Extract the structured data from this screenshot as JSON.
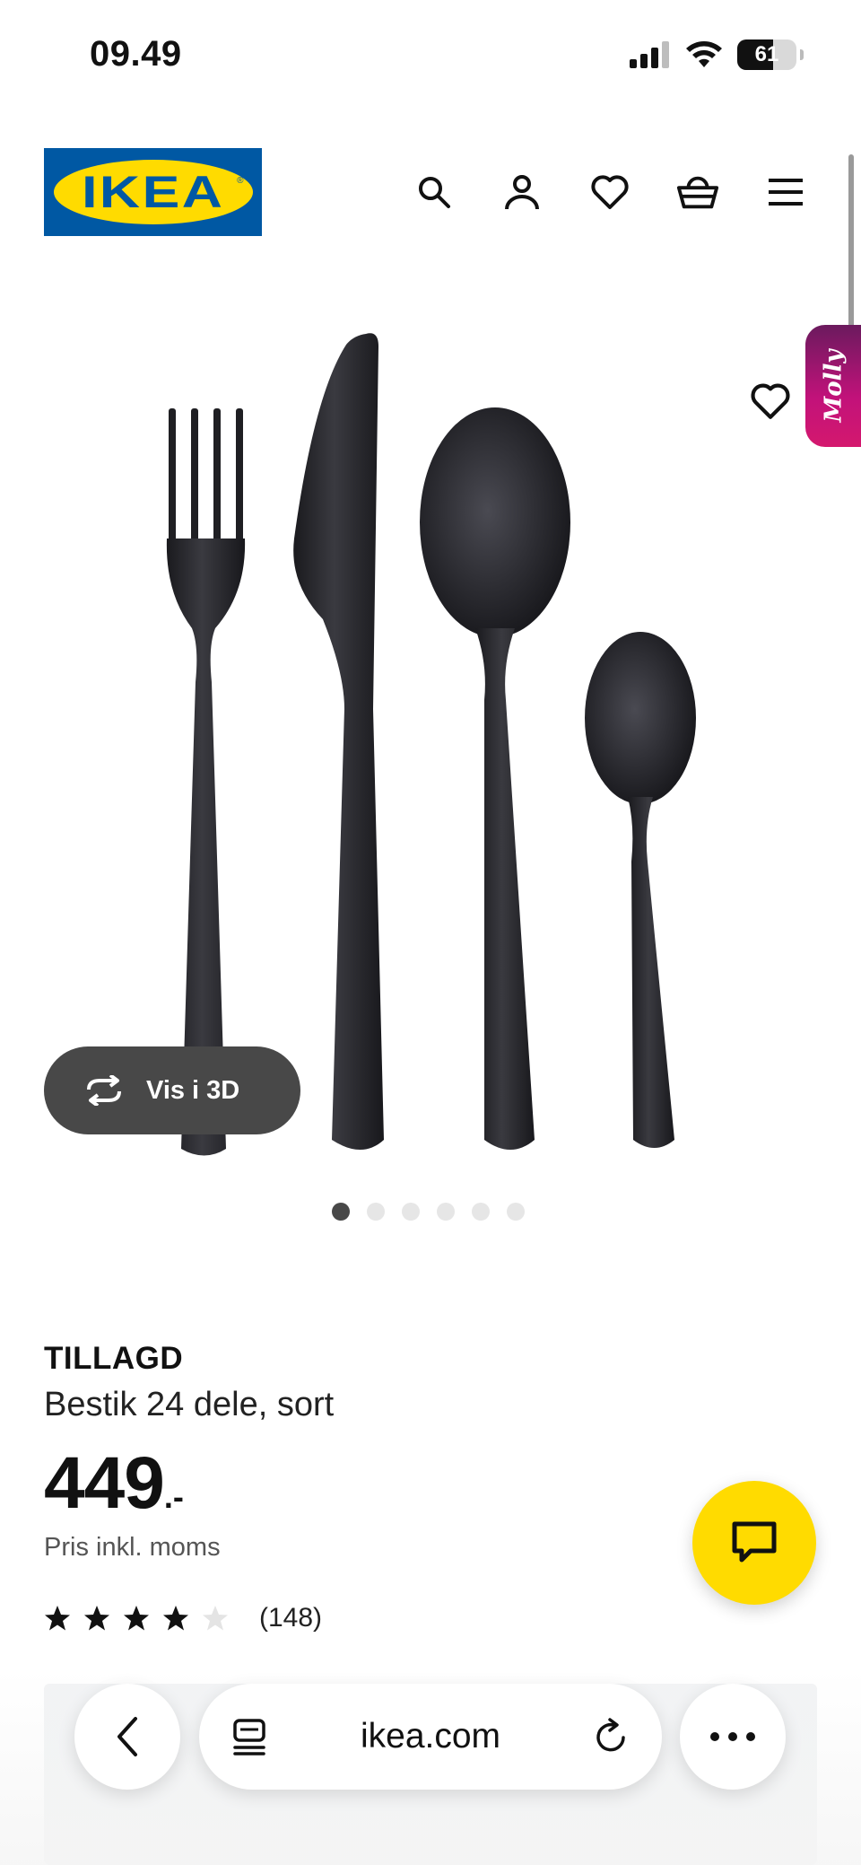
{
  "status_bar": {
    "time": "09.49",
    "battery_level": "61"
  },
  "header": {
    "logo_text": "IKEA",
    "icons": [
      "search-icon",
      "user-icon",
      "heart-icon",
      "basket-icon",
      "menu-icon"
    ]
  },
  "gallery": {
    "vis3d_label": "Vis i 3D",
    "molly_label": "Molly",
    "dots_total": 6,
    "active_dot": 1
  },
  "product": {
    "name": "TILLAGD",
    "description": "Bestik 24 dele, sort",
    "price": "449",
    "price_suffix": ".-",
    "price_note": "Pris inkl. moms",
    "rating_value": 4,
    "rating_max": 5,
    "review_count": "(148)"
  },
  "browser": {
    "url": "ikea.com"
  },
  "colors": {
    "ikea_blue": "#0058a3",
    "ikea_yellow": "#ffdb00",
    "molly_gradient_start": "#6b1a5e",
    "molly_gradient_end": "#d4186e"
  }
}
